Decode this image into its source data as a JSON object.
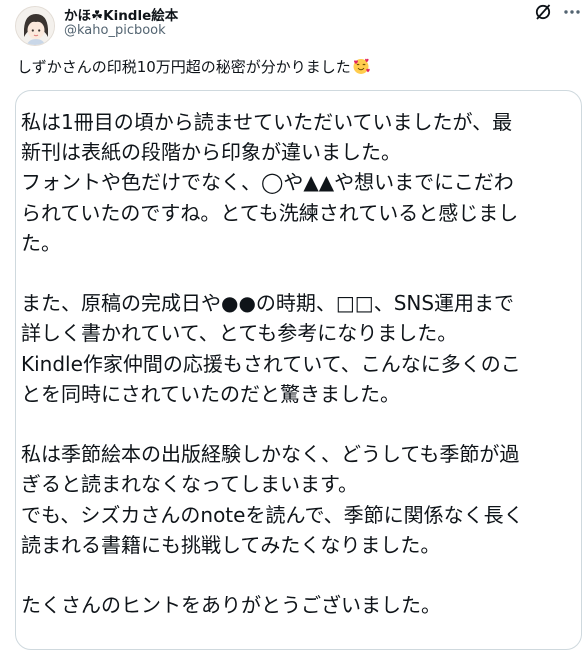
{
  "author": {
    "display_name": "かほ☘Kindle絵本",
    "handle": "@kaho_picbook"
  },
  "icons": {
    "avatar": "avatar-image",
    "grok": "grok-icon",
    "more": "more-icon",
    "emoji": "smiling-face-with-hearts-icon"
  },
  "tweet": {
    "text": "しずかさんの印税10万円超の秘密が分かりました"
  },
  "quote_card": {
    "lines": [
      "私は1冊目の頃から読ませていただいていましたが、最",
      "新刊は表紙の段階から印象が違いました。",
      "フォントや色だけでなく、◯や▲▲や想いまでにこだわ",
      "られていたのですね。とても洗練されていると感じまし",
      "た。",
      "",
      "また、原稿の完成日や●●の時期、□□、SNS運用まで",
      "詳しく書かれていて、とても参考になりました。",
      "Kindle作家仲間の応援もされていて、こんなに多くのこ",
      "とを同時にされていたのだと驚きました。",
      "",
      "私は季節絵本の出版経験しかなく、どうしても季節が過",
      "ぎると読まれなくなってしまいます。",
      "でも、シズカさんのnoteを読んで、季節に関係なく長く",
      "読まれる書籍にも挑戦してみたくなりました。",
      "",
      "たくさんのヒントをありがとうございました。"
    ]
  }
}
